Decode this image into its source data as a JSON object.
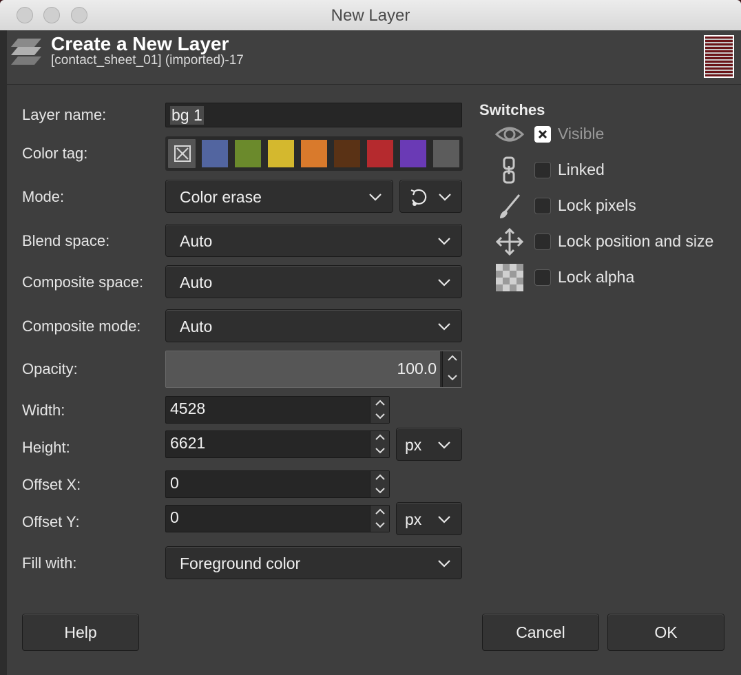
{
  "window": {
    "title": "New Layer"
  },
  "header": {
    "title": "Create a New Layer",
    "subtitle": "[contact_sheet_01] (imported)-17"
  },
  "form": {
    "layer_name_label": "Layer name:",
    "layer_name_value": "bg 1",
    "color_tag_label": "Color tag:",
    "color_tags": [
      "none",
      "#5265a0",
      "#6b8a2c",
      "#d4b82e",
      "#d97a2c",
      "#5a3215",
      "#b52a2e",
      "#6a3ab5",
      "#5c5c5c"
    ],
    "mode_label": "Mode:",
    "mode_value": "Color erase",
    "blend_space_label": "Blend space:",
    "blend_space_value": "Auto",
    "composite_space_label": "Composite space:",
    "composite_space_value": "Auto",
    "composite_mode_label": "Composite mode:",
    "composite_mode_value": "Auto",
    "opacity_label": "Opacity:",
    "opacity_value": "100.0",
    "width_label": "Width:",
    "width_value": "4528",
    "height_label": "Height:",
    "height_value": "6621",
    "size_unit": "px",
    "offset_x_label": "Offset X:",
    "offset_x_value": "0",
    "offset_y_label": "Offset Y:",
    "offset_y_value": "0",
    "offset_unit": "px",
    "fill_label": "Fill with:",
    "fill_value": "Foreground color"
  },
  "switches": {
    "title": "Switches",
    "items": [
      {
        "label": "Visible",
        "icon": "eye-icon",
        "checked": true
      },
      {
        "label": "Linked",
        "icon": "chain-icon",
        "checked": false
      },
      {
        "label": "Lock pixels",
        "icon": "paintbrush-icon",
        "checked": false
      },
      {
        "label": "Lock position and size",
        "icon": "move-arrows-icon",
        "checked": false
      },
      {
        "label": "Lock alpha",
        "icon": "checkerboard-icon",
        "checked": false
      }
    ]
  },
  "buttons": {
    "help": "Help",
    "cancel": "Cancel",
    "ok": "OK"
  }
}
